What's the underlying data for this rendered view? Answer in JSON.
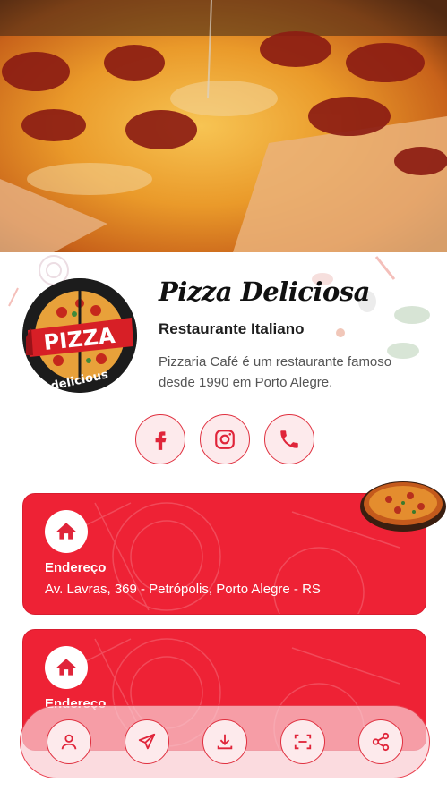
{
  "hero": {
    "image": "pizza-photo"
  },
  "profile": {
    "logo_text": "PIZZA",
    "logo_subtext": "delicious",
    "name": "Pizza Deliciosa",
    "category": "Restaurante Italiano",
    "description": "Pizzaria Café é um restaurante famoso desde 1990 em Porto Alegre."
  },
  "socials": [
    {
      "icon": "facebook-icon"
    },
    {
      "icon": "instagram-icon"
    },
    {
      "icon": "phone-icon"
    }
  ],
  "cards": [
    {
      "icon": "home-icon",
      "label": "Endereço",
      "value": "Av. Lavras, 369 - Petrópolis, Porto Alegre - RS"
    },
    {
      "icon": "home-icon",
      "label": "Endereço",
      "value": ""
    }
  ],
  "bottom_nav": [
    {
      "icon": "user-icon"
    },
    {
      "icon": "send-icon"
    },
    {
      "icon": "download-icon"
    },
    {
      "icon": "scan-icon"
    },
    {
      "icon": "share-icon"
    }
  ],
  "colors": {
    "accent": "#ee2235",
    "accent_light": "#fdeaec"
  }
}
